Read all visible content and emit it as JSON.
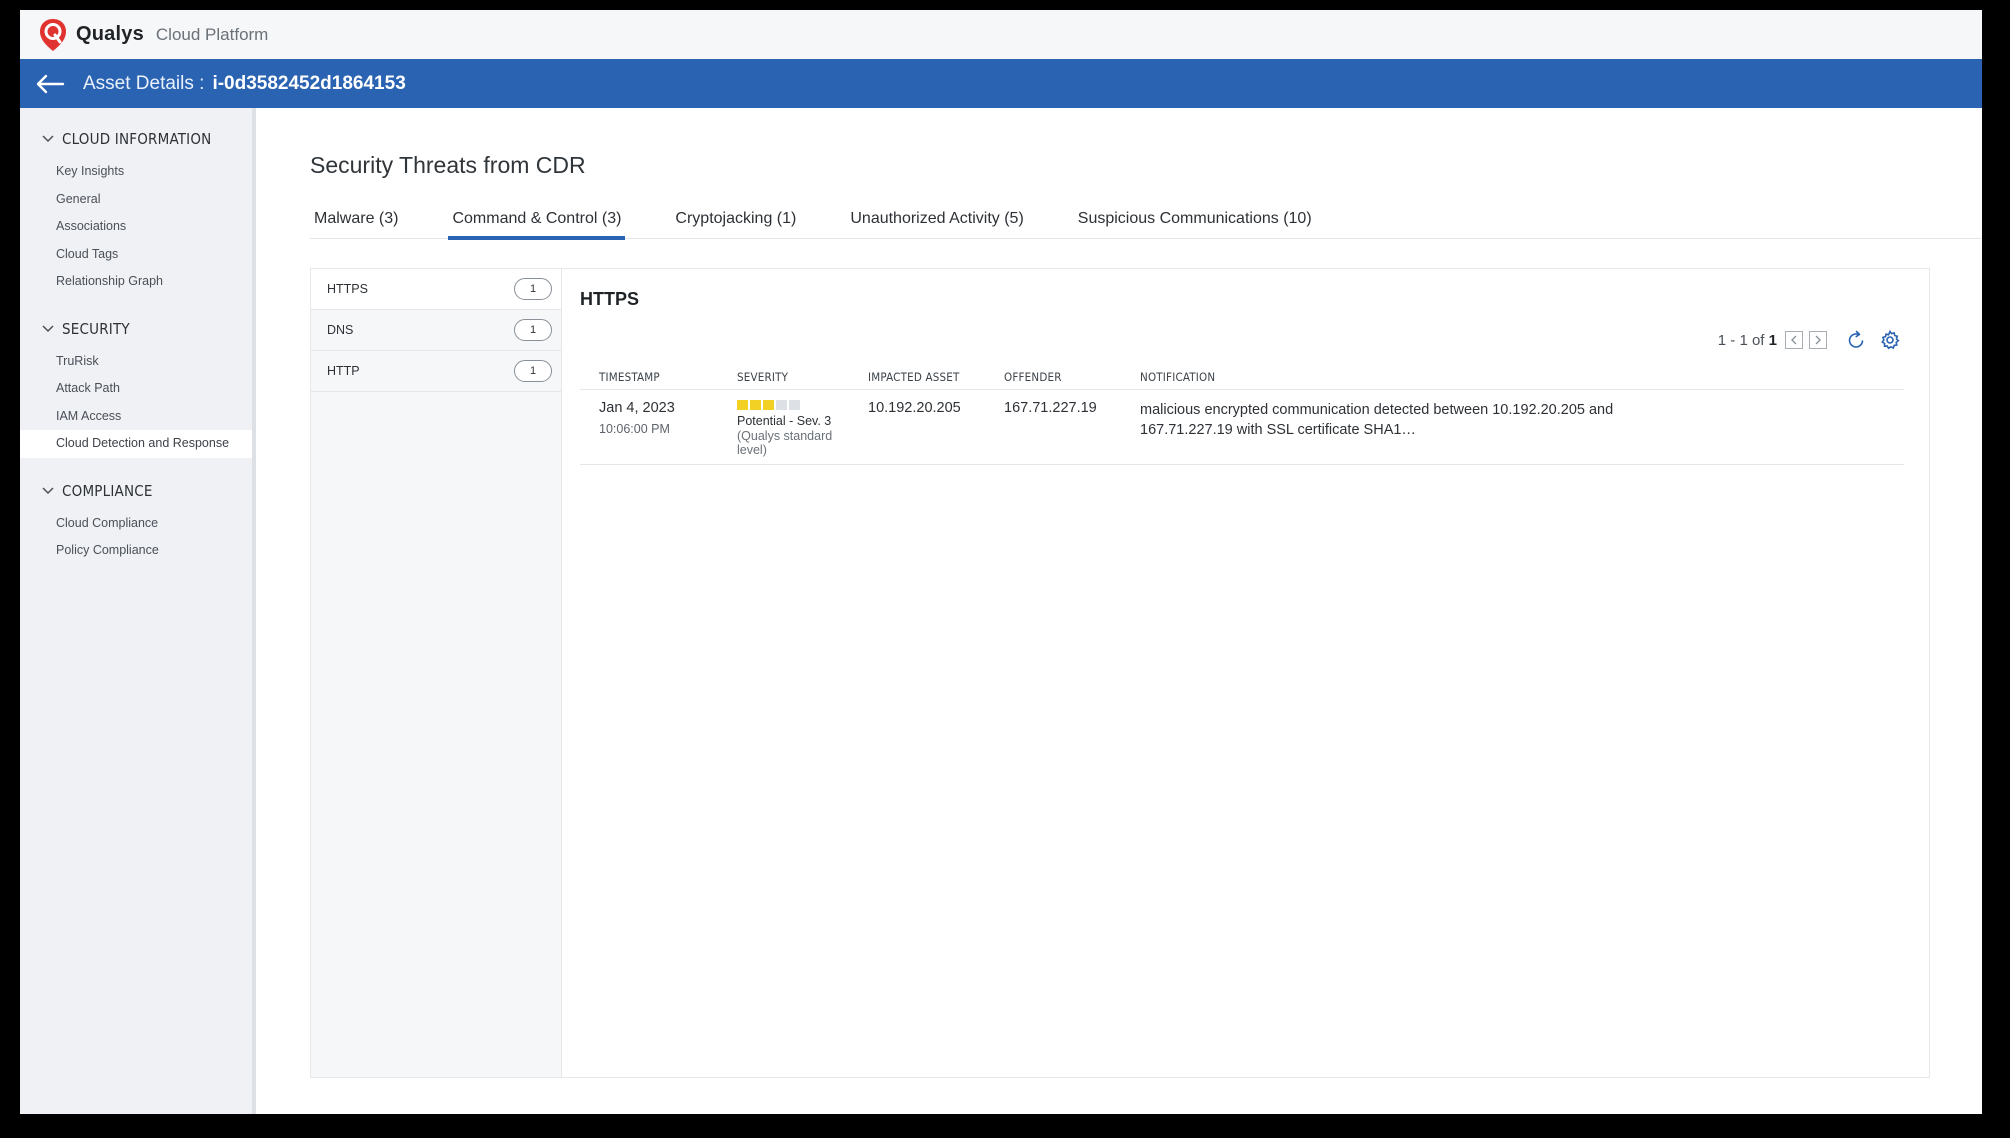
{
  "brand": {
    "name": "Qualys",
    "product": "Cloud Platform",
    "accent": "#e0332f"
  },
  "asset_bar": {
    "label": "Asset Details :",
    "asset_id": "i-0d3582452d1864153",
    "color": "#2a63b2"
  },
  "sidebar": {
    "sections": [
      {
        "title": "CLOUD INFORMATION",
        "items": [
          "Key Insights",
          "General",
          "Associations",
          "Cloud Tags",
          "Relationship Graph"
        ]
      },
      {
        "title": "SECURITY",
        "items": [
          "TruRisk",
          "Attack Path",
          "IAM Access",
          "Cloud Detection and Response"
        ],
        "active_item": "Cloud Detection and Response"
      },
      {
        "title": "COMPLIANCE",
        "items": [
          "Cloud Compliance",
          "Policy Compliance"
        ]
      }
    ]
  },
  "main": {
    "title": "Security Threats from CDR",
    "tabs": [
      {
        "label": "Malware (3)"
      },
      {
        "label": "Command & Control (3)",
        "active": true
      },
      {
        "label": "Cryptojacking (1)"
      },
      {
        "label": "Unauthorized Activity (5)"
      },
      {
        "label": "Suspicious Communications (10)"
      }
    ],
    "protocols": [
      {
        "label": "HTTPS",
        "count": "1"
      },
      {
        "label": "DNS",
        "count": "1"
      },
      {
        "label": "HTTP",
        "count": "1"
      }
    ],
    "detail": {
      "title": "HTTPS",
      "pager": {
        "range": "1 - 1 of",
        "total": "1"
      },
      "columns": [
        "TIMESTAMP",
        "SEVERITY",
        "IMPACTED ASSET",
        "OFFENDER",
        "NOTIFICATION"
      ],
      "rows": [
        {
          "date": "Jan 4, 2023",
          "time": "10:06:00 PM",
          "severity_level": 3,
          "severity_max": 5,
          "severity_label": "Potential - Sev. 3",
          "severity_sub": "(Qualys standard level)",
          "impacted_asset": "10.192.20.205",
          "offender": "167.71.227.19",
          "notification": "malicious encrypted communication detected between 10.192.20.205 and 167.71.227.19 with SSL certificate SHA1…"
        }
      ]
    }
  }
}
